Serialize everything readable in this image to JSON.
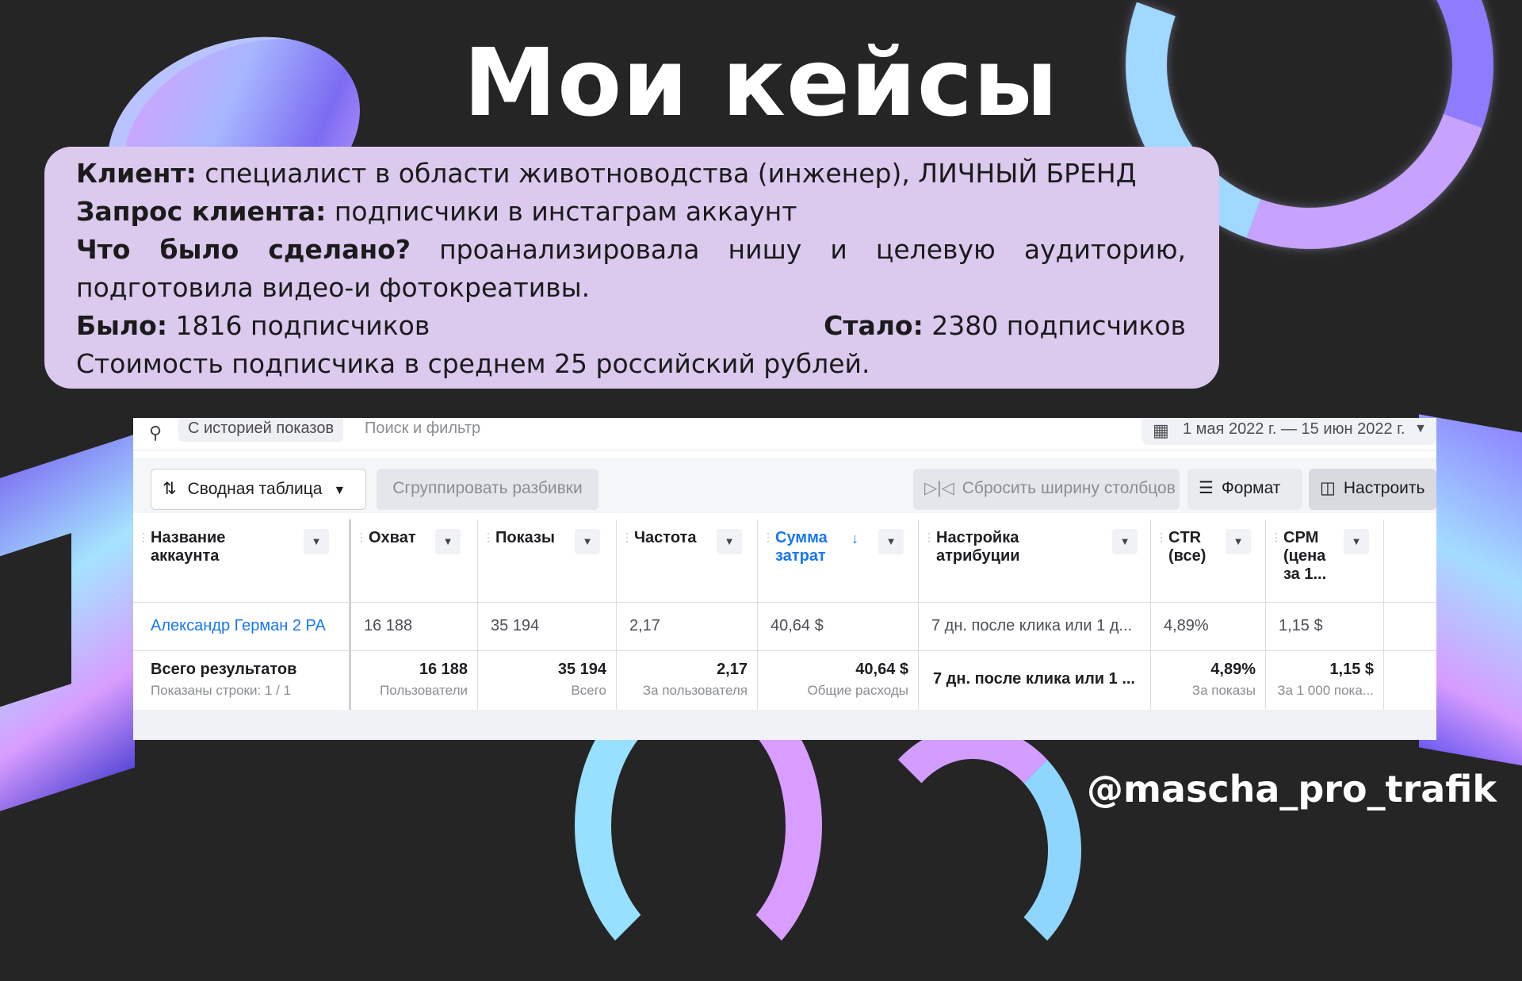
{
  "title": "Мои кейсы",
  "case": {
    "client_label": "Клиент:",
    "client_value": " специалист в области животноводства (инженер), ЛИЧНЫЙ БРЕНД",
    "request_label": "Запрос клиента:",
    "request_value": " подписчики в инстаграм аккаунт",
    "work_label": "Что было сделано?",
    "work_value": " проанализировала нишу и целевую аудиторию, подготовила видео-и фотокреативы.",
    "before_label": "Было:",
    "before_value": " 1816 подписчиков",
    "after_label": "Стало:",
    "after_value": " 2380 подписчиков",
    "cost_text": "Стоимость подписчика в среднем 25 российский рублей."
  },
  "ads": {
    "search": {
      "history_chip": "С историей показов",
      "placeholder": "Поиск и фильтр",
      "date_range": "1 мая 2022 г. — 15 июн 2022 г."
    },
    "toolbar": {
      "pivot_label": "Сводная таблица",
      "group_label": "Сгруппировать разбивки",
      "reset_label": "Сбросить ширину столбцов",
      "format_label": "Формат",
      "customize_label": "Настроить"
    },
    "columns": [
      "Название аккаунта",
      "Охват",
      "Показы",
      "Частота",
      "Сумма затрат",
      "Настройка атрибуции",
      "CTR (все)",
      "CPM (цена за 1..."
    ],
    "row": [
      "Александр Герман 2 РА",
      "16 188",
      "35 194",
      "2,17",
      "40,64 $",
      "7 дн. после клика или 1 д...",
      "4,89%",
      "1,15 $"
    ],
    "totals": {
      "label": "Всего результатов",
      "sublabel": "Показаны строки: 1 / 1",
      "values": [
        "16 188",
        "35 194",
        "2,17",
        "40,64 $",
        "7 дн. после клика или 1 ...",
        "4,89%",
        "1,15 $"
      ],
      "subs": [
        "Пользователи",
        "Всего",
        "За пользователя",
        "Общие расходы",
        "",
        "За показы",
        "За 1 000 пока..."
      ]
    }
  },
  "handle": "@mascha_pro_trafik",
  "colors": {
    "background": "#252525",
    "card": "#dbc9ee",
    "link": "#1877f2"
  }
}
